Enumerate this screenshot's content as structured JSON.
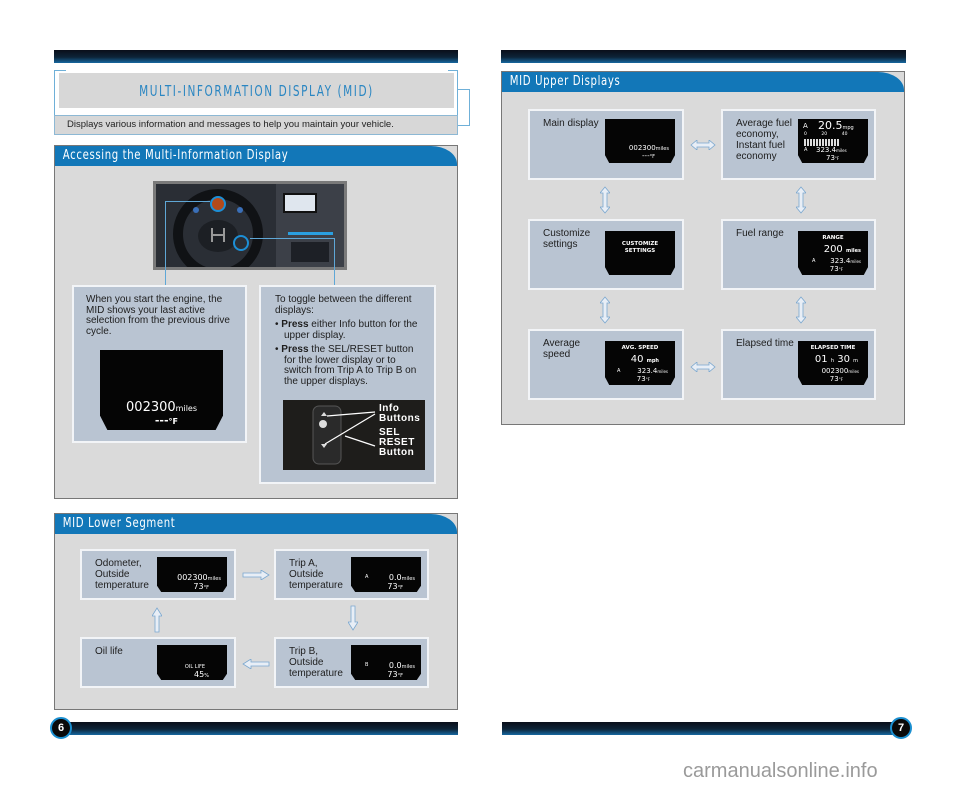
{
  "page": {
    "title": "MULTI-INFORMATION DISPLAY (MID)",
    "subtitle": "Displays various information and messages to help you maintain your vehicle.",
    "page_left": "6",
    "page_right": "7",
    "watermark": "carmanualsonline.info",
    "colors": {
      "accent": "#1277b8",
      "title_text": "#2a86c2",
      "panel_bg": "#dadada",
      "card_bg": "#b9c4d2",
      "bar_dark": "#0a0f1a"
    }
  },
  "accessing": {
    "heading": "Accessing the Multi-Information Display",
    "left_text": "When you start the engine, the MID shows your last active selection from the previous drive cycle.",
    "left_lcd": {
      "line1": "002300",
      "line1_unit": "miles",
      "line2": "---",
      "line2_unit": "°F"
    },
    "right_intro": "To toggle between the different displays:",
    "bullets": [
      {
        "bold": "Press",
        "text": " either Info button for the upper display."
      },
      {
        "bold": "Press",
        "text": " the SEL/RESET button for the lower display or to switch from Trip A to Trip B on the upper displays."
      }
    ],
    "photo_labels": {
      "info": "Info",
      "buttons": "Buttons",
      "sel": "SEL",
      "reset": "RESET",
      "button": "Button"
    }
  },
  "lower": {
    "heading": "MID Lower Segment",
    "cards": [
      {
        "label": "Odometer, Outside temperature",
        "l1": "002300",
        "u1": "miles",
        "l2": "73",
        "u2": "°F"
      },
      {
        "label": "Trip A, Outside temperature",
        "prefix": "A",
        "l1": "0.0",
        "u1": "miles",
        "l2": "73",
        "u2": "°F"
      },
      {
        "label": "Oil life",
        "l1": "OIL LIFE",
        "l2": "45",
        "u2": "%"
      },
      {
        "label": "Trip B, Outside temperature",
        "prefix": "B",
        "l1": "0.0",
        "u1": "miles",
        "l2": "73",
        "u2": "°F"
      }
    ]
  },
  "upper": {
    "heading": "MID Upper Displays",
    "cards": [
      {
        "label": "Main display",
        "l1": "002300",
        "u1": "miles",
        "l2": "---",
        "u2": "°F"
      },
      {
        "label": "Average fuel economy, Instant fuel economy",
        "prefix": "A",
        "big": "20.5",
        "big_unit": "mpg",
        "scale": [
          "0",
          "20",
          "40"
        ],
        "trip": "323.4",
        "trip_unit": "miles",
        "temp": "73",
        "temp_unit": "°F"
      },
      {
        "label": "Customize settings",
        "l1": "CUSTOMIZE",
        "l2": "SETTINGS"
      },
      {
        "label": "Fuel range",
        "title": "RANGE",
        "big": "200",
        "big_unit": "miles",
        "prefix": "A",
        "trip": "323.4",
        "trip_unit": "miles",
        "temp": "73",
        "temp_unit": "°F"
      },
      {
        "label": "Average speed",
        "title": "AVG. SPEED",
        "big": "40",
        "big_unit": "mph",
        "prefix": "A",
        "trip": "323.4",
        "trip_unit": "miles",
        "temp": "73",
        "temp_unit": "°F"
      },
      {
        "label": "Elapsed time",
        "title": "ELAPSED TIME",
        "hours": "01",
        "h_unit": "h",
        "mins": "30",
        "m_unit": "m",
        "odo": "002300",
        "odo_unit": "miles",
        "temp": "73",
        "temp_unit": "°F"
      }
    ]
  }
}
